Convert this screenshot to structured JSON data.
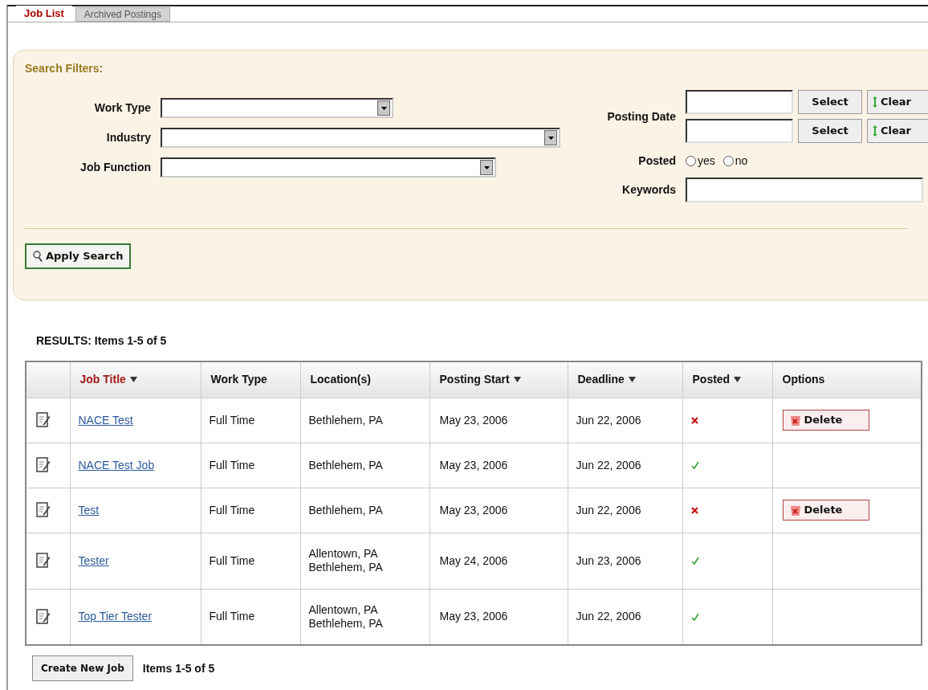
{
  "tabs": [
    {
      "label": "Job List",
      "selected": true
    },
    {
      "label": "Archived Postings",
      "selected": false
    }
  ],
  "filters": {
    "title": "Search Filters:",
    "selects": [
      {
        "label": "Work Type"
      },
      {
        "label": "Industry"
      },
      {
        "label": "Job Function"
      }
    ],
    "posting_date": {
      "label": "Posting Date",
      "rows": [
        {
          "select": "Select",
          "clear": "Clear"
        },
        {
          "select": "Select",
          "clear": "Clear"
        }
      ]
    },
    "posted": {
      "label": "Posted",
      "options": [
        {
          "label": "yes",
          "selected": false
        },
        {
          "label": "no",
          "selected": false
        }
      ]
    },
    "keywords": {
      "label": "Keywords"
    },
    "apply": "Apply Search"
  },
  "results_label": "RESULTS: Items 1-5 of 5",
  "table": {
    "columns": [
      {
        "label": "Job Title",
        "sortable": true,
        "active": true
      },
      {
        "label": "Work Type",
        "sortable": false,
        "active": false
      },
      {
        "label": "Location(s)",
        "sortable": false,
        "active": false
      },
      {
        "label": "Posting Start",
        "sortable": true,
        "active": false
      },
      {
        "label": "Deadline",
        "sortable": true,
        "active": false
      },
      {
        "label": "Posted",
        "sortable": true,
        "active": false
      },
      {
        "label": "Options",
        "sortable": false,
        "active": false
      }
    ],
    "rows": [
      {
        "title": "NACE Test",
        "work_type": "Full Time",
        "locations": [
          "Bethlehem, PA"
        ],
        "start": "May 23, 2006",
        "deadline": "Jun 22, 2006",
        "posted": false,
        "option": "Delete"
      },
      {
        "title": "NACE Test Job",
        "work_type": "Full Time",
        "locations": [
          "Bethlehem, PA"
        ],
        "start": "May 23, 2006",
        "deadline": "Jun 22, 2006",
        "posted": true
      },
      {
        "title": "Test",
        "work_type": "Full Time",
        "locations": [
          "Bethlehem, PA"
        ],
        "start": "May 23, 2006",
        "deadline": "Jun 22, 2006",
        "posted": false,
        "option": "Delete"
      },
      {
        "title": "Tester",
        "work_type": "Full Time",
        "locations": [
          "Allentown, PA",
          "Bethlehem, PA"
        ],
        "start": "May 24, 2006",
        "deadline": "Jun 23, 2006",
        "posted": true
      },
      {
        "title": "Top Tier Tester",
        "work_type": "Full Time",
        "locations": [
          "Allentown, PA",
          "Bethlehem, PA"
        ],
        "start": "May 23, 2006",
        "deadline": "Jun 22, 2006",
        "posted": true
      }
    ]
  },
  "footer": {
    "button": "Create New Job",
    "count": "Items 1-5 of 5"
  }
}
